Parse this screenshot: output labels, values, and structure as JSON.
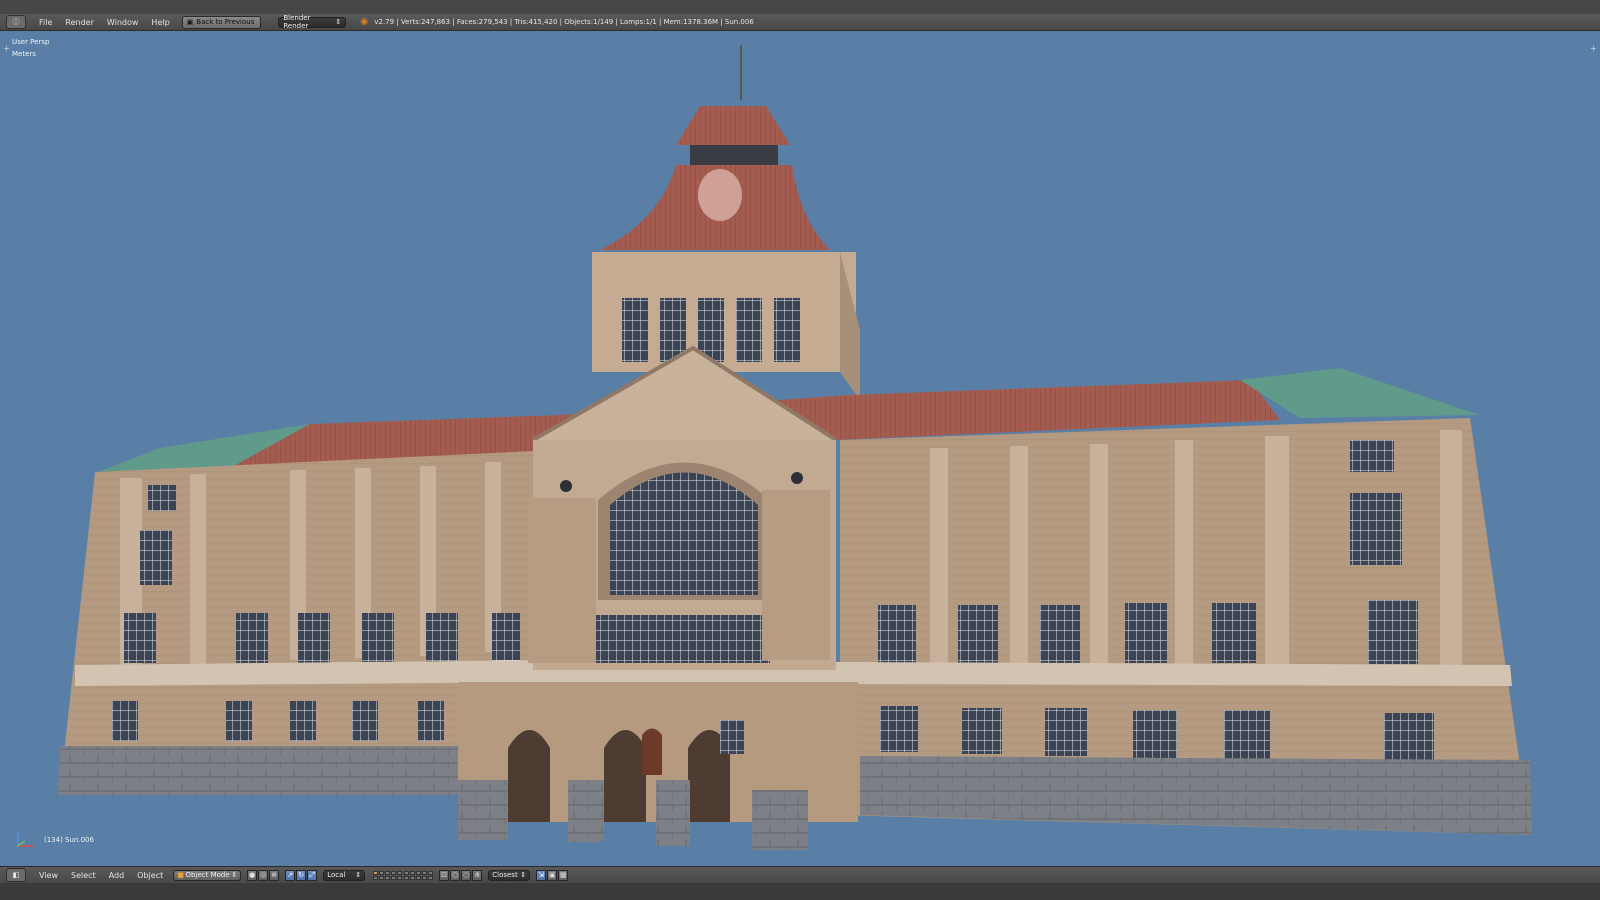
{
  "header": {
    "editor_icon": "info-icon",
    "menus": [
      "File",
      "Render",
      "Window",
      "Help"
    ],
    "back_label": "Back to Previous",
    "engine": "Blender Render",
    "stats": "v2.79 | Verts:247,863 | Faces:279,543 | Tris:415,420 | Objects:1/149 | Lamps:1/1 | Mem:1378.36M | Sun.006"
  },
  "viewport": {
    "view_name": "User Persp",
    "units": "Meters",
    "active_object": "(134) Sun.006",
    "background_color": "#5a7fa6"
  },
  "footer": {
    "editor_icon": "3d-view-icon",
    "menus": [
      "View",
      "Select",
      "Add",
      "Object"
    ],
    "mode": "Object Mode",
    "pivot": "Local",
    "snap": "Closest"
  },
  "colors": {
    "ui_dark": "#484848",
    "wall": "#b89f87",
    "roof_red": "#a55c50",
    "roof_copper": "#5f9a8a",
    "stone_base": "#7d8086"
  }
}
